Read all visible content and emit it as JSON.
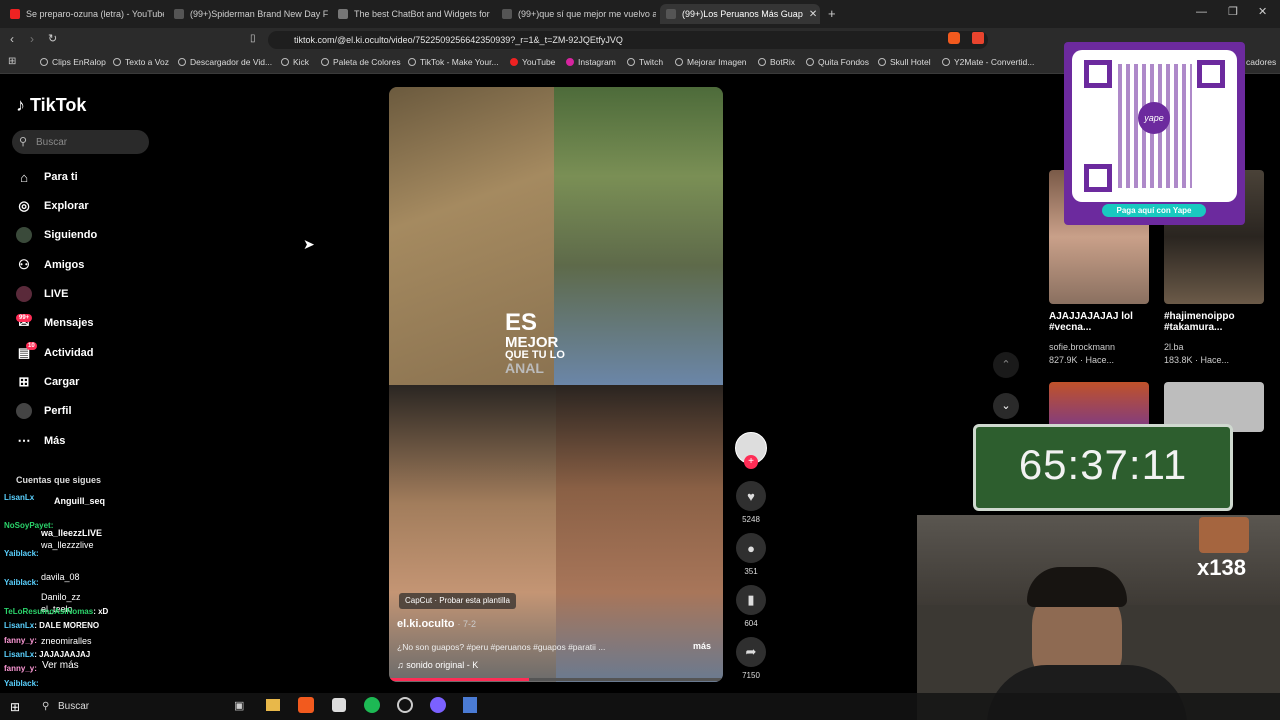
{
  "browser": {
    "tabs": [
      {
        "title": "Se preparo-ozuna (letra) - YouTube",
        "fav": "#e22"
      },
      {
        "title": "(99+)Spiderman Brand New Day Full",
        "fav": "#333"
      },
      {
        "title": "The best ChatBot and Widgets for Ki",
        "fav": "#444"
      },
      {
        "title": "(99+)que sí que mejor me vuelvo a g",
        "fav": "#333"
      },
      {
        "title": "(99+)Los Peruanos Más Guap",
        "fav": "#333"
      }
    ],
    "new_tab": "+",
    "url": "tiktok.com/@el.ki.oculto/video/7522509256642350939?_r=1&_t=ZM-92JQEtfyJVQ",
    "bookmarks": [
      "Clips EnRalop",
      "Texto a Voz",
      "Descargador de Vid...",
      "Kick",
      "Paleta de Colores",
      "TikTok - Make Your...",
      "YouTube",
      "Instagram",
      "Twitch",
      "Mejorar Imagen",
      "BotRix",
      "Quita Fondos",
      "Skull Hotel",
      "Y2Mate - Convertid...",
      "cadores"
    ]
  },
  "tiktok": {
    "logo": "TikTok",
    "search_placeholder": "Buscar",
    "nav": [
      {
        "label": "Para ti",
        "icon": "home-icon"
      },
      {
        "label": "Explorar",
        "icon": "compass-icon"
      },
      {
        "label": "Siguiendo",
        "icon": "following-icon"
      },
      {
        "label": "Amigos",
        "icon": "friends-icon"
      },
      {
        "label": "LIVE",
        "icon": "live-icon"
      },
      {
        "label": "Mensajes",
        "icon": "message-icon",
        "badge": "99+"
      },
      {
        "label": "Actividad",
        "icon": "activity-icon",
        "badge": "10"
      },
      {
        "label": "Cargar",
        "icon": "upload-icon"
      },
      {
        "label": "Perfil",
        "icon": "profile-icon"
      },
      {
        "label": "Más",
        "icon": "more-icon"
      }
    ],
    "following_header": "Cuentas que sigues",
    "following": [
      "Anguill_seq",
      "wa_lleezzLIVE",
      "wa_llezzzlive",
      "davila_08",
      "Danilo_zz",
      "el_teelo",
      "zneomiralles"
    ],
    "see_more": "Ver más"
  },
  "video": {
    "overlay_text": [
      "ES",
      "MEJOR",
      "QUE TU LO",
      "ANAL"
    ],
    "capcut": "CapCut · Probar esta plantilla",
    "author": "el.ki.oculto",
    "date": "· 7-2",
    "caption": "¿No son guapos? #peru #peruanos #guapos #paratii ...",
    "more": "más",
    "sound": "sonido original - K",
    "progress": 0.42
  },
  "actions": [
    {
      "name": "like",
      "icon": "heart-icon",
      "count": "5248"
    },
    {
      "name": "comment",
      "icon": "comment-icon",
      "count": "351"
    },
    {
      "name": "save",
      "icon": "bookmark-icon",
      "count": "604"
    },
    {
      "name": "share",
      "icon": "share-icon",
      "count": "7150"
    }
  ],
  "recommended": [
    {
      "title": "AJAJJAJAJAJ lol #vecna...",
      "author": "sofie.brockmann",
      "stats": "827.9K · Hace..."
    },
    {
      "title": "#hajimenoippo #takamura...",
      "author": "2l.ba",
      "stats": "183.8K · Hace..."
    }
  ],
  "stream": {
    "qr_caption": "Paga aquí con Yape",
    "qr_brand": "yape",
    "timer": "65:37:11",
    "counter": "x138",
    "chat": [
      {
        "user": "LisanLx",
        "text": "",
        "color": "#5ad1ff"
      },
      {
        "user": "NoSoyPayet",
        "text": ":",
        "color": "#2bd46b"
      },
      {
        "user": "Yaiblack",
        "text": ":",
        "color": "#5ad1ff"
      },
      {
        "user": "Yaiblack",
        "text": ":",
        "color": "#5ad1ff"
      },
      {
        "user": "TeLoResumoAsiNomas",
        "text": ": xD",
        "color": "#2bd46b"
      },
      {
        "user": "LisanLx",
        "text": ": DALE MORENO",
        "color": "#5ad1ff"
      },
      {
        "user": "fanny_y",
        "text": ":",
        "color": "#ff9ad8"
      },
      {
        "user": "LisanLx",
        "text": ": JAJAJAAJAJ",
        "color": "#5ad1ff"
      },
      {
        "user": "fanny_y",
        "text": ":",
        "color": "#ff9ad8"
      },
      {
        "user": "Yaiblack",
        "text": ":",
        "color": "#5ad1ff"
      }
    ]
  },
  "taskbar": {
    "search": "Buscar"
  }
}
